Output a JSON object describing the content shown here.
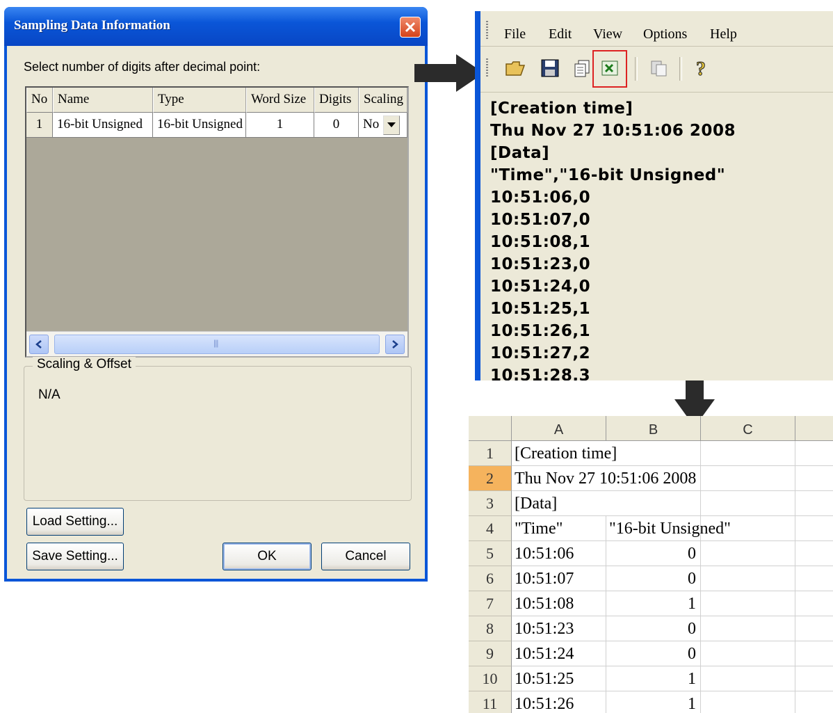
{
  "dialog": {
    "title": "Sampling Data Information",
    "instruction": "Select number of digits after decimal point:",
    "columns": [
      "No",
      "Name",
      "Type",
      "Word Size",
      "Digits",
      "Scaling"
    ],
    "row": {
      "no": "1",
      "name": "16-bit Unsigned",
      "type": "16-bit Unsigned",
      "word_size": "1",
      "digits": "0",
      "scaling": "No"
    },
    "group_label": "Scaling & Offset",
    "group_value": "N/A",
    "buttons": {
      "load": "Load Setting...",
      "save": "Save Setting...",
      "ok": "OK",
      "cancel": "Cancel"
    }
  },
  "editor": {
    "menu": [
      "File",
      "Edit",
      "View",
      "Options",
      "Help"
    ],
    "toolbar_icons": [
      "open-folder-icon",
      "save-disk-icon",
      "copy-pages-icon",
      "excel-export-icon",
      "paste-icon",
      "help-icon"
    ],
    "lines": [
      "[Creation time]",
      "Thu Nov 27 10:51:06 2008",
      "[Data]",
      "\"Time\",\"16-bit Unsigned\"",
      "10:51:06,0",
      "10:51:07,0",
      "10:51:08,1",
      "10:51:23,0",
      "10:51:24,0",
      "10:51:25,1",
      "10:51:26,1",
      "10:51:27,2",
      "10:51:28,3"
    ]
  },
  "sheet": {
    "columns": [
      "A",
      "B",
      "C"
    ],
    "active_row": "2",
    "rows": [
      {
        "n": "1",
        "a": "[Creation time]",
        "b": "",
        "c": ""
      },
      {
        "n": "2",
        "a": "Thu Nov 27 10:51:06 2008",
        "b": "",
        "c": ""
      },
      {
        "n": "3",
        "a": "[Data]",
        "b": "",
        "c": ""
      },
      {
        "n": "4",
        "a": "\"Time\"",
        "b": "\"16-bit Unsigned\"",
        "c": ""
      },
      {
        "n": "5",
        "a": "10:51:06",
        "b": "0",
        "c": ""
      },
      {
        "n": "6",
        "a": "10:51:07",
        "b": "0",
        "c": ""
      },
      {
        "n": "7",
        "a": "10:51:08",
        "b": "1",
        "c": ""
      },
      {
        "n": "8",
        "a": "10:51:23",
        "b": "0",
        "c": ""
      },
      {
        "n": "9",
        "a": "10:51:24",
        "b": "0",
        "c": ""
      },
      {
        "n": "10",
        "a": "10:51:25",
        "b": "1",
        "c": ""
      },
      {
        "n": "11",
        "a": "10:51:26",
        "b": "1",
        "c": ""
      }
    ]
  },
  "colors": {
    "xp_blue": "#0a56d8",
    "dialog_face": "#ece9d8",
    "highlight_border": "#dd2222",
    "active_row_header": "#f5b35d",
    "arrow": "#2b2b2b"
  }
}
